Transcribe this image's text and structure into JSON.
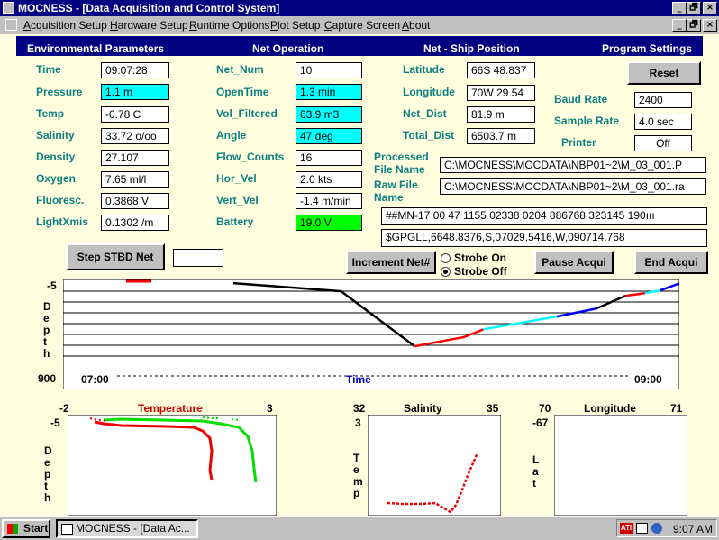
{
  "window": {
    "title": "MOCNESS - [Data Acquisition and Control System]",
    "btn_min": "_",
    "btn_max": "🗗",
    "btn_close": "×"
  },
  "menu": [
    {
      "accel": "A",
      "rest": "cquisition Setup"
    },
    {
      "accel": "H",
      "rest": "ardware Setup"
    },
    {
      "accel": "R",
      "rest": "untime Options"
    },
    {
      "accel": "P",
      "rest": "lot Setup"
    },
    {
      "accel": "C",
      "rest": "apture Screen"
    },
    {
      "accel": "A",
      "rest": "bout"
    }
  ],
  "sections": {
    "env": "Environmental Parameters",
    "net": "Net Operation",
    "pos": "Net - Ship Position",
    "prog": "Program Settings"
  },
  "env": [
    {
      "label": "Time",
      "value": "09:07:28",
      "hl": ""
    },
    {
      "label": "Pressure",
      "value": "1.1 m",
      "hl": "cyan"
    },
    {
      "label": "Temp",
      "value": "-0.78 C",
      "hl": ""
    },
    {
      "label": "Salinity",
      "value": "33.72 o/oo",
      "hl": ""
    },
    {
      "label": "Density",
      "value": "27.107",
      "hl": ""
    },
    {
      "label": "Oxygen",
      "value": "7.65 ml/l",
      "hl": ""
    },
    {
      "label": "Fluoresc.",
      "value": "0.3868 V",
      "hl": ""
    },
    {
      "label": "LightXmis",
      "value": "0.1302 /m",
      "hl": ""
    }
  ],
  "net": [
    {
      "label": "Net_Num",
      "value": "10",
      "hl": ""
    },
    {
      "label": "OpenTime",
      "value": "1.3 min",
      "hl": "cyan"
    },
    {
      "label": "Vol_Filtered",
      "value": "63.9 m3",
      "hl": "cyan"
    },
    {
      "label": "Angle",
      "value": "47 deg",
      "hl": "cyan"
    },
    {
      "label": "Flow_Counts",
      "value": "16",
      "hl": ""
    },
    {
      "label": "Hor_Vel",
      "value": "2.0 kts",
      "hl": ""
    },
    {
      "label": "Vert_Vel",
      "value": "-1.4 m/min",
      "hl": ""
    },
    {
      "label": "Battery",
      "value": "19.0 V",
      "hl": "green"
    }
  ],
  "pos": [
    {
      "label": "Latitude",
      "value": "66S 48.837"
    },
    {
      "label": "Longitude",
      "value": "70W 29.54"
    },
    {
      "label": "Net_Dist",
      "value": "81.9 m"
    },
    {
      "label": "Total_Dist",
      "value": "6503.7 m"
    }
  ],
  "prog": {
    "reset": "Reset",
    "baud_label": "Baud Rate",
    "baud": "2400",
    "sample_label": "Sample Rate",
    "sample": "4.0 sec",
    "printer_label": "Printer",
    "printer": "Off"
  },
  "files": {
    "processed_label1": "Processed",
    "processed_label2": "File Name",
    "processed": "C:\\MOCNESS\\MOCDATA\\NBP01~2\\M_03_001.P",
    "raw_label1": "Raw File",
    "raw_label2": "Name",
    "raw": "C:\\MOCNESS\\MOCDATA\\NBP01~2\\M_03_001.ra"
  },
  "strings": {
    "mn": "##MN-17 00 47 1155 02338 0204 886768 323145 190",
    "gpgll": "$GPGLL,6648.8376,S,07029.5416,W,090714.768"
  },
  "controls": {
    "step": "Step STBD Net",
    "step_value": "",
    "increment": "Increment Net#",
    "strobe_on": "Strobe On",
    "strobe_off": "Strobe Off",
    "pause": "Pause Acqui",
    "end": "End Acqui"
  },
  "depth_chart": {
    "ymin_label": "-5",
    "ymax_label": "900",
    "ylabel": "Depth",
    "x_start": "07:00",
    "x_end": "09:00",
    "xlabel": "Time"
  },
  "profiles": {
    "temp": {
      "left": "-2",
      "title": "Temperature",
      "right": "3",
      "top": "-5",
      "ylabel": "Depth"
    },
    "sal": {
      "left": "32",
      "title": "Salinity",
      "right": "35",
      "top": "3",
      "ylabel": "Temp"
    },
    "lon": {
      "left": "70",
      "title": "Longitude",
      "right": "71",
      "top": "-67",
      "ylabel": "Lat"
    }
  },
  "taskbar": {
    "start": "Start",
    "task": "MOCNESS - [Data Ac...",
    "clock": "9:07 AM"
  },
  "colors": {
    "title_blue": "#000080",
    "panel_bg": "#ffffe0",
    "label_teal": "#0e7f7f",
    "cyan": "#00ffff",
    "green": "#00ff00",
    "series": [
      "#000000",
      "#ff0000",
      "#00ffff",
      "#0000ff"
    ]
  },
  "chart_data": {
    "type": "line",
    "title": "",
    "xlabel": "Time",
    "ylabel": "Depth",
    "xlim": [
      "07:00",
      "09:00"
    ],
    "ylim": [
      -5,
      900
    ],
    "y_inverted": true,
    "grid": true,
    "series": [
      {
        "color": "#000000",
        "points": [
          [
            0.09,
            3
          ],
          [
            0.31,
            65
          ],
          [
            0.46,
            490
          ]
        ]
      },
      {
        "color": "#ff0000",
        "points": [
          [
            0.46,
            490
          ],
          [
            0.56,
            420
          ],
          [
            0.6,
            360
          ]
        ]
      },
      {
        "color": "#00ffff",
        "points": [
          [
            0.6,
            360
          ],
          [
            0.75,
            260
          ]
        ]
      },
      {
        "color": "#0000ff",
        "points": [
          [
            0.75,
            260
          ],
          [
            0.83,
            200
          ]
        ]
      },
      {
        "color": "#000000",
        "points": [
          [
            0.83,
            200
          ],
          [
            0.89,
            100
          ]
        ]
      },
      {
        "color": "#ff0000",
        "points": [
          [
            0.89,
            100
          ],
          [
            0.93,
            80
          ]
        ]
      },
      {
        "color": "#00ffff",
        "points": [
          [
            0.93,
            80
          ],
          [
            0.96,
            60
          ]
        ]
      },
      {
        "color": "#0000ff",
        "points": [
          [
            0.96,
            60
          ],
          [
            1.0,
            5
          ]
        ]
      }
    ]
  }
}
